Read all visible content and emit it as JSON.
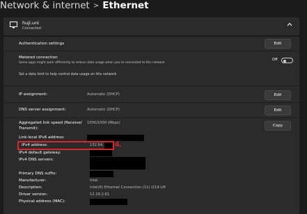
{
  "header": {
    "breadcrumb": "Network & internet",
    "separator": ">",
    "title": "Ethernet"
  },
  "network": {
    "name": "huji.uni",
    "status": "Connected",
    "icon": "ethernet-icon",
    "expand_icon": "chevron-up-icon"
  },
  "auth": {
    "label": "Authentication settings",
    "button": "Edit"
  },
  "metered": {
    "label": "Metered connection",
    "description": "Some apps might work differently to reduce data usage when you're connected to this network",
    "toggle_state": "Off",
    "link": "Set a data limit to help control data usage on this network"
  },
  "ip_assignment": {
    "label": "IP assignment:",
    "value": "Automatic (DHCP)",
    "button": "Edit"
  },
  "dns_assignment": {
    "label": "DNS server assignment:",
    "value": "Automatic (DHCP)",
    "button": "Edit"
  },
  "properties": {
    "link_speed_label": "Aggregated link speed (Receive/\nTransmit):",
    "link_speed_value": "1000/1000 (Mbps)",
    "copy_button": "Copy",
    "ipv6_label": "Link-local IPv6 address:",
    "ipv4_label": "IPv4 address:",
    "ipv4_value": "132.64.",
    "ipv4_gateway_label": "IPv4 default gateway:",
    "ipv4_dns_label": "IPv4 DNS servers:",
    "dns_suffix_label": "Primary DNS suffix:",
    "manufacturer_label": "Manufacturer:",
    "manufacturer_value": "Intel",
    "description_label": "Description:",
    "description_value": "Intel(R) Ethernet Connection (11) I219-LM",
    "driver_label": "Driver version:",
    "driver_value": "12.19.2.61",
    "mac_label": "Physical address (MAC):"
  },
  "annotation": {
    "number": "4.",
    "color": "#e0252e"
  }
}
